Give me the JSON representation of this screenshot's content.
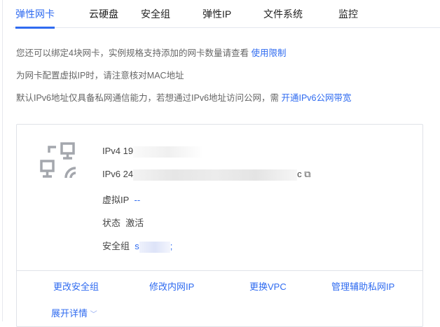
{
  "tabs": [
    "弹性网卡",
    "云硬盘",
    "安全组",
    "弹性IP",
    "文件系统",
    "监控"
  ],
  "notes": {
    "n1": "您还可以绑定4块网卡，实例规格支持添加的网卡数量请查看 ",
    "n1_link": "使用限制",
    "n2": "为网卡配置虚拟IP时，请注意核对MAC地址",
    "n3": "默认IPv6地址仅具备私网通信能力，若想通过IPv6地址访问公网，需 ",
    "n3_link": "开通IPv6公网带宽"
  },
  "card": {
    "ipv4_prefix": "IPv4 19",
    "ipv6_prefix": "IPv6 24",
    "ipv6_suffix": "c",
    "vip_label": "虚拟IP",
    "vip_value": "--",
    "status_label": "状态",
    "status_value": "激活",
    "sg_label": "安全组",
    "sg_prefix": "s",
    "sg_suffix": ";",
    "actions": [
      "更改安全组",
      "修改内网IP",
      "更换VPC",
      "管理辅助私网IP"
    ],
    "expand": "展开详情"
  },
  "colors": {
    "accent": "#2f6bf0"
  }
}
